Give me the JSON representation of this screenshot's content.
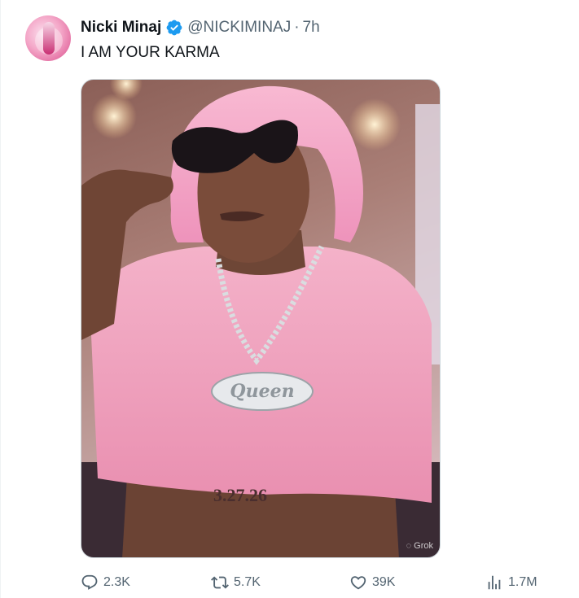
{
  "tweet": {
    "author_name": "Nicki Minaj",
    "handle": "@NICKIMINAJ",
    "separator": "·",
    "time": "7h",
    "text": "I AM YOUR KARMA",
    "verified_icon": "verified-badge-icon",
    "colors": {
      "verified": "#1d9bf0",
      "secondary_text": "#536471",
      "primary_text": "#0f1419",
      "shirt_pink": "#f2a6c1",
      "wig_pink": "#f4a4c6"
    }
  },
  "media": {
    "tattoo_text": "3.27.26",
    "pendant_text": "Queen",
    "watermark": "Grok"
  },
  "actions": {
    "replies": "2.3K",
    "reposts": "5.7K",
    "likes": "39K",
    "views": "1.7M"
  }
}
